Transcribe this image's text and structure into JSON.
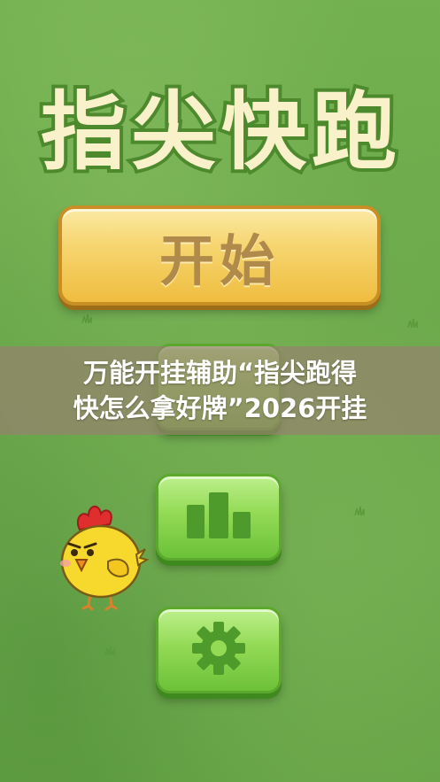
{
  "game": {
    "title": "指尖快跑",
    "start_button_label": "开始"
  },
  "menu": {
    "items": [
      {
        "name": "leaderboard",
        "icon": "bar-chart-icon"
      },
      {
        "name": "settings",
        "icon": "gear-icon"
      }
    ]
  },
  "overlay": {
    "line1": "万能开挂辅助“指尖跑得",
    "line2": "快怎么拿好牌”2026开挂"
  },
  "colors": {
    "background": "#6fad4c",
    "title_fill": "#f8f1c9",
    "title_outline": "#4d8a2e",
    "start_button": "#f6d56f",
    "start_text": "#b08a4a",
    "menu_button": "#93da55",
    "menu_icon": "#4e9a2a",
    "overlay": "#96826e"
  }
}
